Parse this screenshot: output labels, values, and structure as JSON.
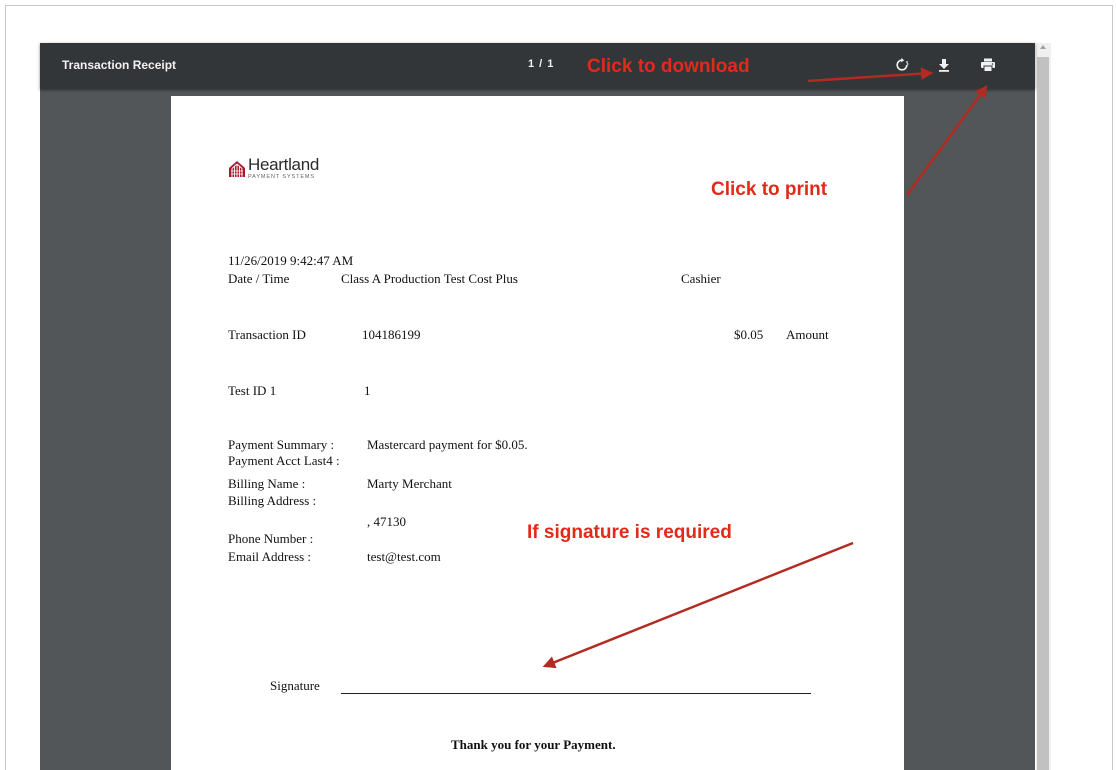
{
  "toolbar": {
    "title": "Transaction Receipt",
    "page_indicator": "1 / 1",
    "icons": [
      "rotate-icon",
      "download-icon",
      "print-icon"
    ]
  },
  "receipt": {
    "logo": {
      "name": "Heartland",
      "subtitle": "PAYMENT SYSTEMS",
      "color": "#a6192e"
    },
    "datetime": "11/26/2019 9:42:47 AM",
    "date_time_label": "Date / Time",
    "merchant": "Class A Production Test Cost Plus",
    "cashier_label": "Cashier",
    "transaction_id_label": "Transaction ID",
    "transaction_id": "104186199",
    "amount_value": "$0.05",
    "amount_label": "Amount",
    "test_id_label": "Test ID 1",
    "test_id_value": "1",
    "payment_summary_label": "Payment Summary :",
    "payment_summary_value": "Mastercard payment for $0.05.",
    "payment_acct_label": "Payment Acct Last4 :",
    "billing_name_label": "Billing Name :",
    "billing_name_value": "Marty Merchant",
    "billing_address_label": "Billing Address :",
    "billing_address_value": ", 47130",
    "phone_label": "Phone Number :",
    "email_label": "Email Address :",
    "email_value": "test@test.com",
    "signature_label": "Signature",
    "thank_you": "Thank you for your Payment."
  },
  "annotations": {
    "download": "Click to download",
    "print": "Click to print",
    "signature": "If signature is required",
    "color": "#e02a1a"
  }
}
